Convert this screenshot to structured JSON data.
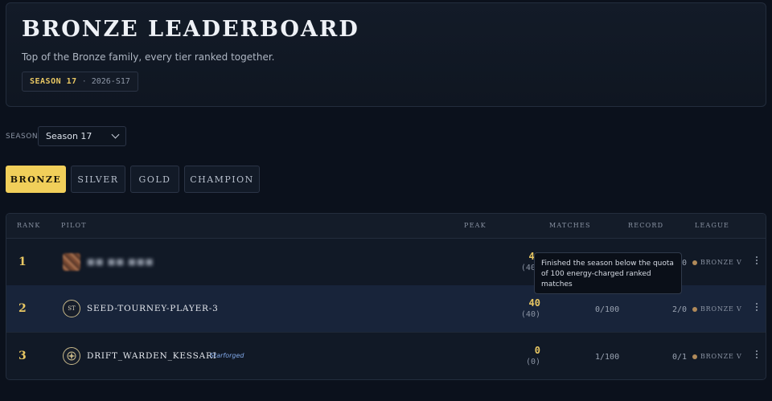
{
  "hero": {
    "title": "BRONZE LEADERBOARD",
    "subtitle": "Top of the Bronze family, every tier ranked together.",
    "season_name": "SEASON 17",
    "separator": "·",
    "season_code": "2026-S17"
  },
  "season_filter": {
    "label": "SEASON",
    "selected": "Season 17"
  },
  "tiers": [
    {
      "label": "BRONZE",
      "active": true
    },
    {
      "label": "SILVER",
      "active": false
    },
    {
      "label": "GOLD",
      "active": false
    },
    {
      "label": "CHAMPION",
      "active": false
    }
  ],
  "table": {
    "headers": {
      "rank": "RANK",
      "pilot": "PILOT",
      "peak": "PEAK",
      "matches": "MATCHES",
      "record": "RECORD",
      "league": "LEAGUE"
    },
    "rows": [
      {
        "rank": "1",
        "pilot": "■■ ■■.■■■",
        "avatar": "",
        "badge": "",
        "peak": "40",
        "peak_sub": "(40)",
        "matches": "",
        "record": "0",
        "league": "BRONZE V"
      },
      {
        "rank": "2",
        "pilot": "SEED-TOURNEY-PLAYER-3",
        "avatar": "ST",
        "badge": "",
        "peak": "40",
        "peak_sub": "(40)",
        "matches": "0/100",
        "record": "2/0",
        "league": "BRONZE V"
      },
      {
        "rank": "3",
        "pilot": "DRIFT_WARDEN_KESSARI",
        "avatar": "",
        "badge": "Starforged",
        "peak": "0",
        "peak_sub": "(0)",
        "matches": "1/100",
        "record": "0/1",
        "league": "BRONZE V"
      }
    ]
  },
  "tooltip": {
    "text": "Finished the season below the quota of 100 energy-charged ranked matches"
  },
  "colors": {
    "accent_gold": "#f1cf5a",
    "rank_gold": "#e8c763",
    "bronze_dot": "#b08a5a",
    "background": "#0b111c"
  }
}
